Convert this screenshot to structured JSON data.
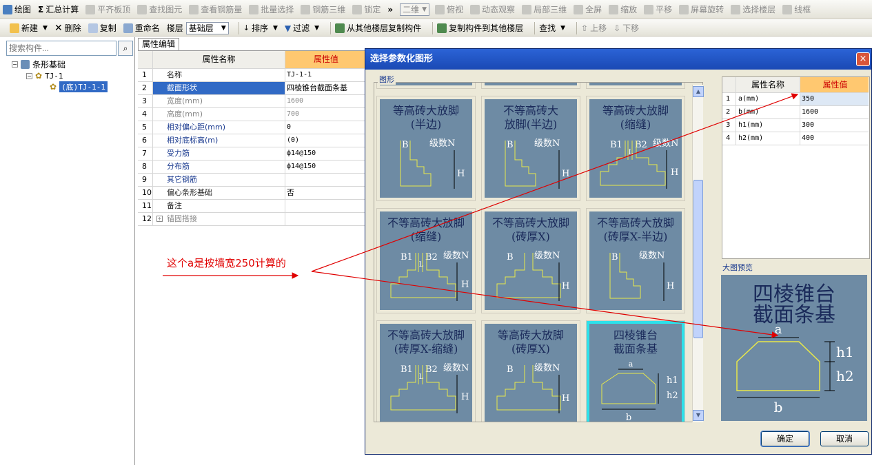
{
  "toolbar1": {
    "items": [
      {
        "label": "绘图",
        "icon": "draw-icon",
        "enabled": true
      },
      {
        "label": "汇总计算",
        "icon": "sigma-icon",
        "enabled": true
      },
      {
        "label": "平齐板顶",
        "icon": "align-icon",
        "enabled": false
      },
      {
        "label": "查找图元",
        "icon": "find-icon",
        "enabled": false
      },
      {
        "label": "查看钢筋量",
        "icon": "rebar-icon",
        "enabled": false
      },
      {
        "label": "批量选择",
        "icon": "batch-icon",
        "enabled": false
      },
      {
        "label": "钢筋三维",
        "icon": "rebar3d-icon",
        "enabled": false
      },
      {
        "label": "锁定",
        "icon": "lock-icon",
        "enabled": false
      }
    ],
    "more": "»",
    "view_combo": "二维",
    "view_items": [
      "俯视",
      "动态观察",
      "局部三维",
      "全屏",
      "缩放",
      "平移",
      "屏幕旋转",
      "选择楼层",
      "线框"
    ]
  },
  "toolbar2": {
    "items": [
      "新建",
      "删除",
      "复制",
      "重命名"
    ],
    "floor_label": "楼层",
    "floor_value": "基础层",
    "sort": "排序",
    "filter": "过滤",
    "copy_from": "从其他楼层复制构件",
    "copy_to": "复制构件到其他楼层",
    "find": "查找",
    "move_up": "上移",
    "move_down": "下移"
  },
  "tree": {
    "search_placeholder": "搜索构件...",
    "root": "条形基础",
    "child": "TJ-1",
    "leaf": "(底)TJ-1-1"
  },
  "props": {
    "tab": "属性编辑",
    "col_name": "属性名称",
    "col_value": "属性值",
    "rows": [
      {
        "n": "1",
        "name": "名称",
        "value": "TJ-1-1"
      },
      {
        "n": "2",
        "name": "截面形状",
        "value": "四棱锥台截面条基"
      },
      {
        "n": "3",
        "name": "宽度(mm)",
        "value": "1600"
      },
      {
        "n": "4",
        "name": "高度(mm)",
        "value": "700"
      },
      {
        "n": "5",
        "name": "相对偏心距(mm)",
        "value": "0"
      },
      {
        "n": "6",
        "name": "相对底标高(m)",
        "value": "(0)"
      },
      {
        "n": "7",
        "name": "受力筋",
        "value": "ф14@150"
      },
      {
        "n": "8",
        "name": "分布筋",
        "value": "ф14@150"
      },
      {
        "n": "9",
        "name": "其它钢筋",
        "value": ""
      },
      {
        "n": "10",
        "name": "偏心条形基础",
        "value": "否"
      },
      {
        "n": "11",
        "name": "备注",
        "value": ""
      },
      {
        "n": "12",
        "name": "锚固搭接",
        "value": "",
        "expand": "+"
      }
    ]
  },
  "annotation": "这个a是按墙宽250计算的",
  "dialog": {
    "title": "选择参数化图形",
    "close": "×",
    "group_shapes": "图形",
    "shapes": [
      {
        "title1": "等高砖大放脚",
        "title2": "(半边)",
        "l1": "B",
        "l2": "级数N",
        "l3": "H"
      },
      {
        "title1": "不等高砖大",
        "title2": "放脚(半边)",
        "l1": "B",
        "l2": "级数N",
        "l3": "H"
      },
      {
        "title1": "等高砖大放脚",
        "title2": "(缩缝)",
        "l1": "B1",
        "l2": "B2",
        "l3": "级数N",
        "l4": "L",
        "l5": "H"
      },
      {
        "title1": "不等高砖大放脚",
        "title2": "(缩缝)",
        "l1": "B1",
        "l2": "B2",
        "l3": "级数N",
        "l4": "L",
        "l5": "H"
      },
      {
        "title1": "不等高砖大放脚",
        "title2": "(砖厚X)",
        "l1": "B",
        "l2": "级数N",
        "l3": "H"
      },
      {
        "title1": "不等高砖大放脚",
        "title2": "(砖厚X-半边)",
        "l1": "B",
        "l2": "级数N",
        "l3": "H"
      },
      {
        "title1": "不等高砖大放脚",
        "title2": "(砖厚X-缩缝)",
        "l1": "B1",
        "l2": "B2",
        "l3": "级数N",
        "l4": "L",
        "l5": "H"
      },
      {
        "title1": "等高砖大放脚",
        "title2": "(砖厚X)",
        "l1": "B",
        "l2": "级数N",
        "l3": "H"
      },
      {
        "title1": "四棱锥台",
        "title2": "截面条基",
        "l1": "a",
        "l2": "h1",
        "l3": "h2",
        "l4": "b"
      }
    ],
    "param_table": {
      "col_name": "属性名称",
      "col_value": "属性值",
      "rows": [
        {
          "n": "1",
          "name": "a(mm)",
          "value": "350"
        },
        {
          "n": "2",
          "name": "b(mm)",
          "value": "1600"
        },
        {
          "n": "3",
          "name": "h1(mm)",
          "value": "300"
        },
        {
          "n": "4",
          "name": "h2(mm)",
          "value": "400"
        }
      ]
    },
    "group_preview": "大图预览",
    "preview": {
      "title1": "四棱锥台",
      "title2": "截面条基",
      "a": "a",
      "h1": "h1",
      "h2": "h2",
      "b": "b"
    },
    "ok": "确定",
    "cancel": "取消"
  },
  "colors": {
    "accent": "#316ac5",
    "header_value_bg": "#ffc870",
    "annotation": "#e00000",
    "shape_bg": "#6e8ba4",
    "shape_line": "#e8e84a",
    "selected_border": "#2de1ea"
  }
}
